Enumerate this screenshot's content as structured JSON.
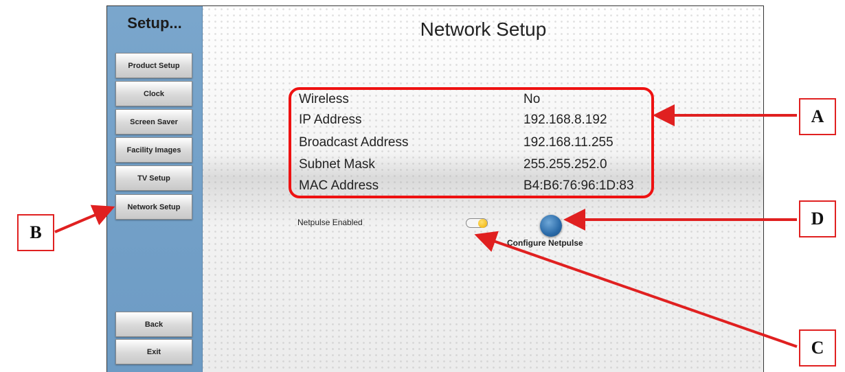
{
  "sidebar": {
    "title": "Setup...",
    "items": [
      {
        "label": "Product Setup"
      },
      {
        "label": "Clock"
      },
      {
        "label": "Screen Saver"
      },
      {
        "label": "Facility Images"
      },
      {
        "label": "TV Setup"
      },
      {
        "label": "Network Setup"
      }
    ],
    "back_label": "Back",
    "exit_label": "Exit"
  },
  "main": {
    "title": "Network Setup",
    "network_info": [
      {
        "label": "Wireless",
        "value": "No"
      },
      {
        "label": "IP Address",
        "value": "192.168.8.192"
      },
      {
        "label": "Broadcast Address",
        "value": "192.168.11.255"
      },
      {
        "label": "Subnet Mask",
        "value": "255.255.252.0"
      },
      {
        "label": "MAC Address",
        "value": "B4:B6:76:96:1D:83"
      }
    ],
    "netpulse_label": "Netpulse Enabled",
    "netpulse_enabled": true,
    "configure_label": "Configure Netpulse"
  },
  "callouts": {
    "a": "A",
    "b": "B",
    "c": "C",
    "d": "D"
  },
  "colors": {
    "sidebar": "#72a0c8",
    "annotation": "#e02020",
    "toggle_knob": "#f5b800",
    "configure_button": "#2a6aa8"
  }
}
